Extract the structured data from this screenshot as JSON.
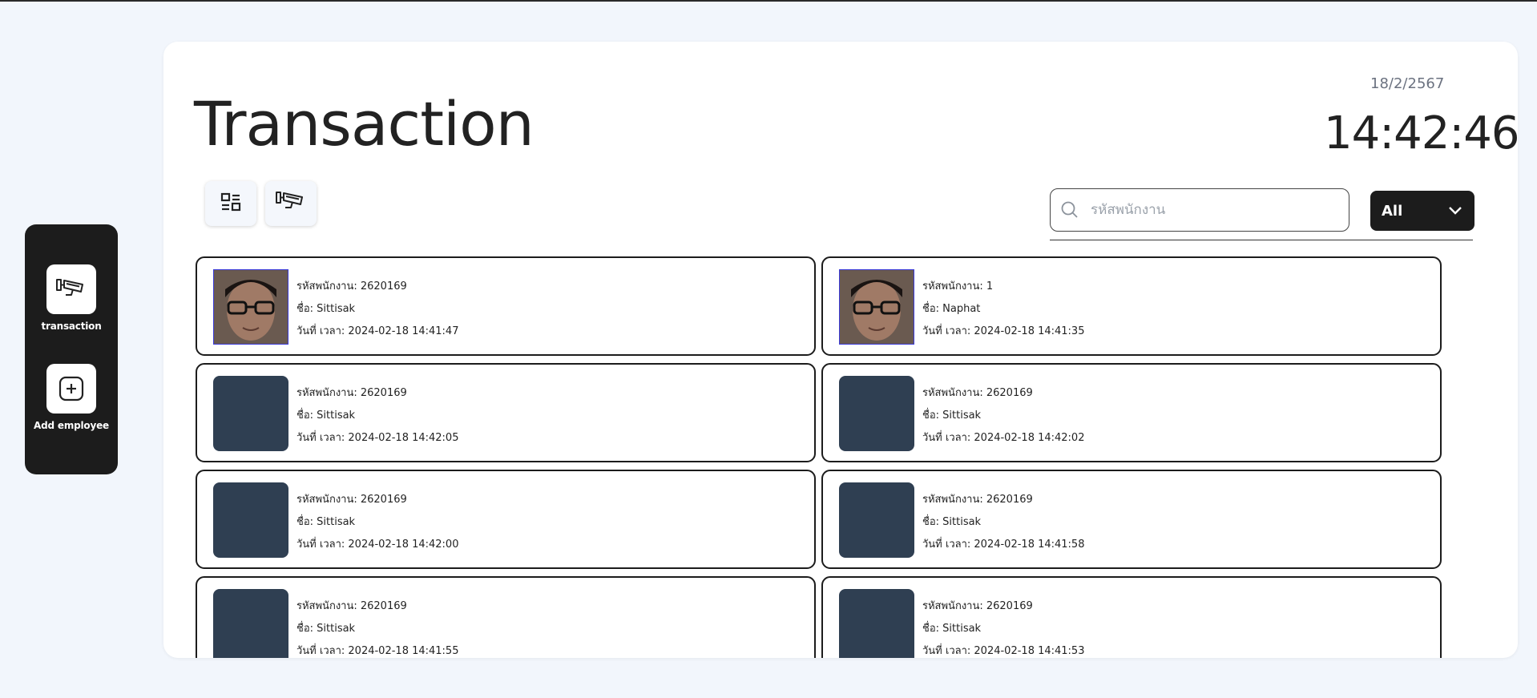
{
  "app": {
    "title": "Transaction"
  },
  "sidebar": {
    "items": [
      {
        "label": "transaction",
        "icon": "cctv-camera-icon"
      },
      {
        "label": "Add employee",
        "icon": "add-square-icon"
      }
    ]
  },
  "header": {
    "date": "18/2/2567",
    "time": "14:42:46"
  },
  "toolbar": {
    "views": [
      {
        "icon": "dashboard-layout-icon"
      },
      {
        "icon": "cctv-camera-icon"
      }
    ],
    "search": {
      "placeholder": "รหัสพนักงาน",
      "value": ""
    },
    "filter": {
      "selected": "All"
    }
  },
  "records": [
    {
      "employee_id": "รหัสพนักงาน: 2620169",
      "name": "ชื่อ: Sittisak",
      "datetime": "วันที่ เวลา: 2024-02-18 14:41:47",
      "photo": "face"
    },
    {
      "employee_id": "รหัสพนักงาน: 1",
      "name": "ชื่อ: Naphat",
      "datetime": "วันที่ เวลา: 2024-02-18 14:41:35",
      "photo": "face"
    },
    {
      "employee_id": "รหัสพนักงาน: 2620169",
      "name": "ชื่อ: Sittisak",
      "datetime": "วันที่ เวลา: 2024-02-18 14:42:05",
      "photo": "broken"
    },
    {
      "employee_id": "รหัสพนักงาน: 2620169",
      "name": "ชื่อ: Sittisak",
      "datetime": "วันที่ เวลา: 2024-02-18 14:42:02",
      "photo": "broken"
    },
    {
      "employee_id": "รหัสพนักงาน: 2620169",
      "name": "ชื่อ: Sittisak",
      "datetime": "วันที่ เวลา: 2024-02-18 14:42:00",
      "photo": "broken"
    },
    {
      "employee_id": "รหัสพนักงาน: 2620169",
      "name": "ชื่อ: Sittisak",
      "datetime": "วันที่ เวลา: 2024-02-18 14:41:58",
      "photo": "broken"
    },
    {
      "employee_id": "รหัสพนักงาน: 2620169",
      "name": "ชื่อ: Sittisak",
      "datetime": "วันที่ เวลา: 2024-02-18 14:41:55",
      "photo": "broken"
    },
    {
      "employee_id": "รหัสพนักงาน: 2620169",
      "name": "ชื่อ: Sittisak",
      "datetime": "วันที่ เวลา: 2024-02-18 14:41:53",
      "photo": "broken"
    }
  ]
}
